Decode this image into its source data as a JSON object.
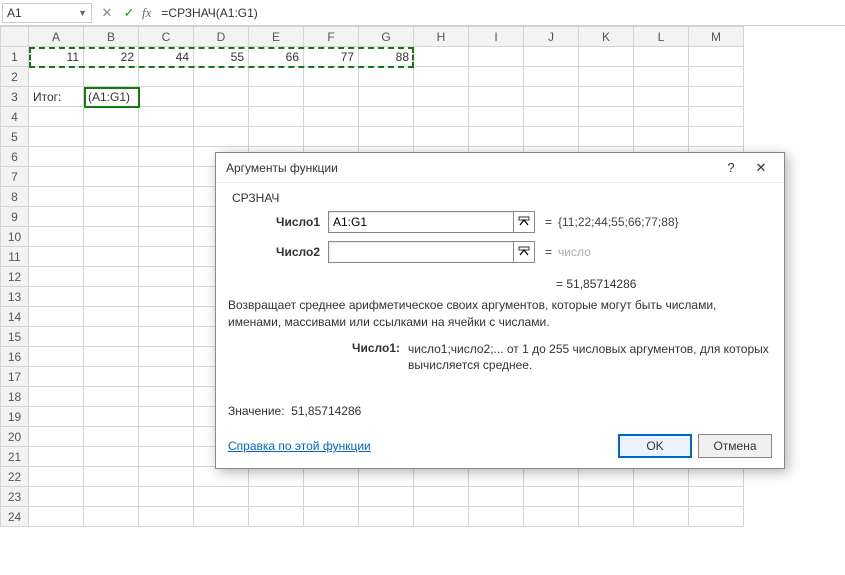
{
  "formula_bar": {
    "name_box": "A1",
    "formula": "=СРЗНАЧ(A1:G1)"
  },
  "columns": [
    "A",
    "B",
    "C",
    "D",
    "E",
    "F",
    "G",
    "H",
    "I",
    "J",
    "K",
    "L",
    "M"
  ],
  "rows": [
    "1",
    "2",
    "3",
    "4",
    "5",
    "6",
    "7",
    "8",
    "9",
    "10",
    "11",
    "12",
    "13",
    "14",
    "15",
    "16",
    "17",
    "18",
    "19",
    "20",
    "21",
    "22",
    "23",
    "24"
  ],
  "cells": {
    "A1": "11",
    "B1": "22",
    "C1": "44",
    "D1": "55",
    "E1": "66",
    "F1": "77",
    "G1": "88",
    "A3": "Итог:",
    "B3": "(A1:G1)"
  },
  "dialog": {
    "title": "Аргументы функции",
    "func_name": "СРЗНАЧ",
    "arg1_label": "Число1",
    "arg1_value": "A1:G1",
    "arg1_preview": "{11;22;44;55;66;77;88}",
    "arg2_label": "Число2",
    "arg2_value": "",
    "arg2_preview": "число",
    "result_prefix": "=   ",
    "result_value": "51,85714286",
    "description": "Возвращает среднее арифметическое своих аргументов, которые могут быть числами, именами, массивами или ссылками на ячейки с числами.",
    "arg_help_label": "Число1:",
    "arg_help_text": "число1;число2;... от 1 до 255 числовых аргументов, для которых вычисляется среднее.",
    "value_label": "Значение:",
    "value_text": "51,85714286",
    "help_link": "Справка по этой функции",
    "ok": "OK",
    "cancel": "Отмена"
  }
}
